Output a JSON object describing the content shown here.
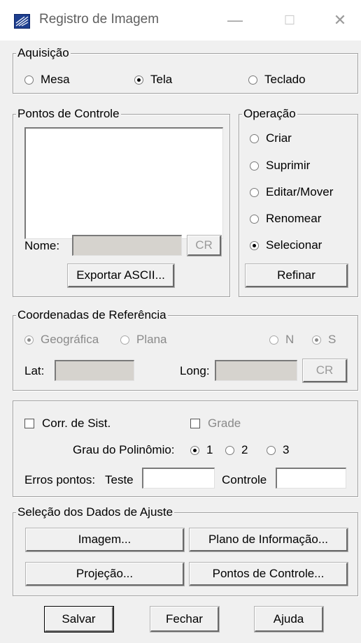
{
  "window": {
    "title": "Registro de Imagem",
    "minimize": "—",
    "maximize": "☐",
    "close": "✕"
  },
  "aquisicao": {
    "label": "Aquisição",
    "options": [
      "Mesa",
      "Tela",
      "Teclado"
    ],
    "selected": "Tela"
  },
  "pontos": {
    "label": "Pontos de Controle",
    "nome_label": "Nome:",
    "nome_value": "",
    "cr_button": "CR",
    "exportar_button": "Exportar ASCII..."
  },
  "operacao": {
    "label": "Operação",
    "options": [
      "Criar",
      "Suprimir",
      "Editar/Mover",
      "Renomear",
      "Selecionar"
    ],
    "selected": "Selecionar",
    "refinar_button": "Refinar"
  },
  "coordenadas": {
    "label": "Coordenadas de Referência",
    "geografica": "Geográfica",
    "plana": "Plana",
    "n": "N",
    "s": "S",
    "lat_label": "Lat:",
    "long_label": "Long:",
    "lat_value": "",
    "long_value": "",
    "cr_button": "CR"
  },
  "ajustes": {
    "corr_sist": "Corr. de Sist.",
    "grade": "Grade",
    "grau_label": "Grau do Polinômio:",
    "grau_options": [
      "1",
      "2",
      "3"
    ],
    "grau_selected": "1",
    "erros_label": "Erros pontos:",
    "teste_label": "Teste",
    "teste_value": "",
    "controle_label": "Controle",
    "controle_value": ""
  },
  "selecao": {
    "label": "Seleção dos Dados de Ajuste",
    "imagem_button": "Imagem...",
    "plano_button": "Plano de Informação...",
    "projecao_button": "Projeção...",
    "pontos_button": "Pontos de Controle..."
  },
  "footer": {
    "salvar": "Salvar",
    "fechar": "Fechar",
    "ajuda": "Ajuda"
  }
}
